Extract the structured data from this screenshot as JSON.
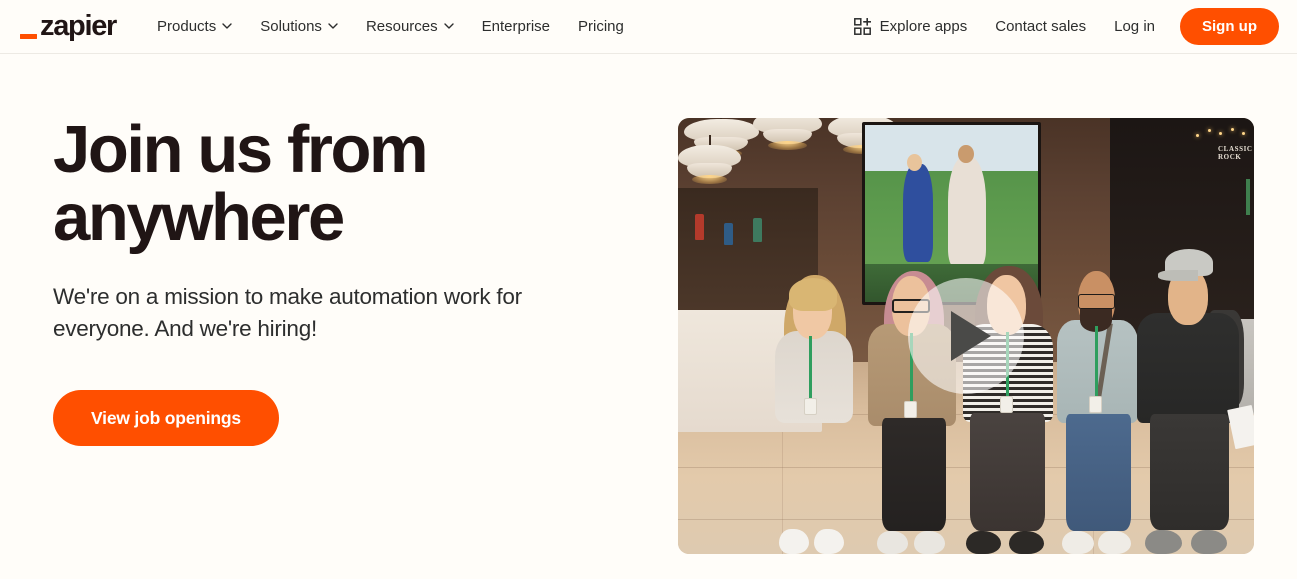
{
  "brand": {
    "logo_text": "zapier",
    "accent_color": "#FF4F00",
    "text_color": "#201515",
    "background_color": "#FFFDF9"
  },
  "navbar": {
    "links": [
      {
        "label": "Products",
        "has_dropdown": true
      },
      {
        "label": "Solutions",
        "has_dropdown": true
      },
      {
        "label": "Resources",
        "has_dropdown": true
      },
      {
        "label": "Enterprise",
        "has_dropdown": false
      },
      {
        "label": "Pricing",
        "has_dropdown": false
      }
    ],
    "explore_apps": {
      "label": "Explore apps",
      "icon": "grid-plus-icon"
    },
    "contact_sales": "Contact sales",
    "log_in": "Log in",
    "sign_up": "Sign up"
  },
  "hero": {
    "title": "Join us from anywhere",
    "subtitle": "We're on a mission to make automation work for everyone. And we're hiring!",
    "cta_label": "View job openings",
    "media": {
      "type": "video",
      "play_button_label": "Play video",
      "description": "Five Zapier employees wearing conference lanyards smiling together in a convention centre lobby"
    }
  }
}
